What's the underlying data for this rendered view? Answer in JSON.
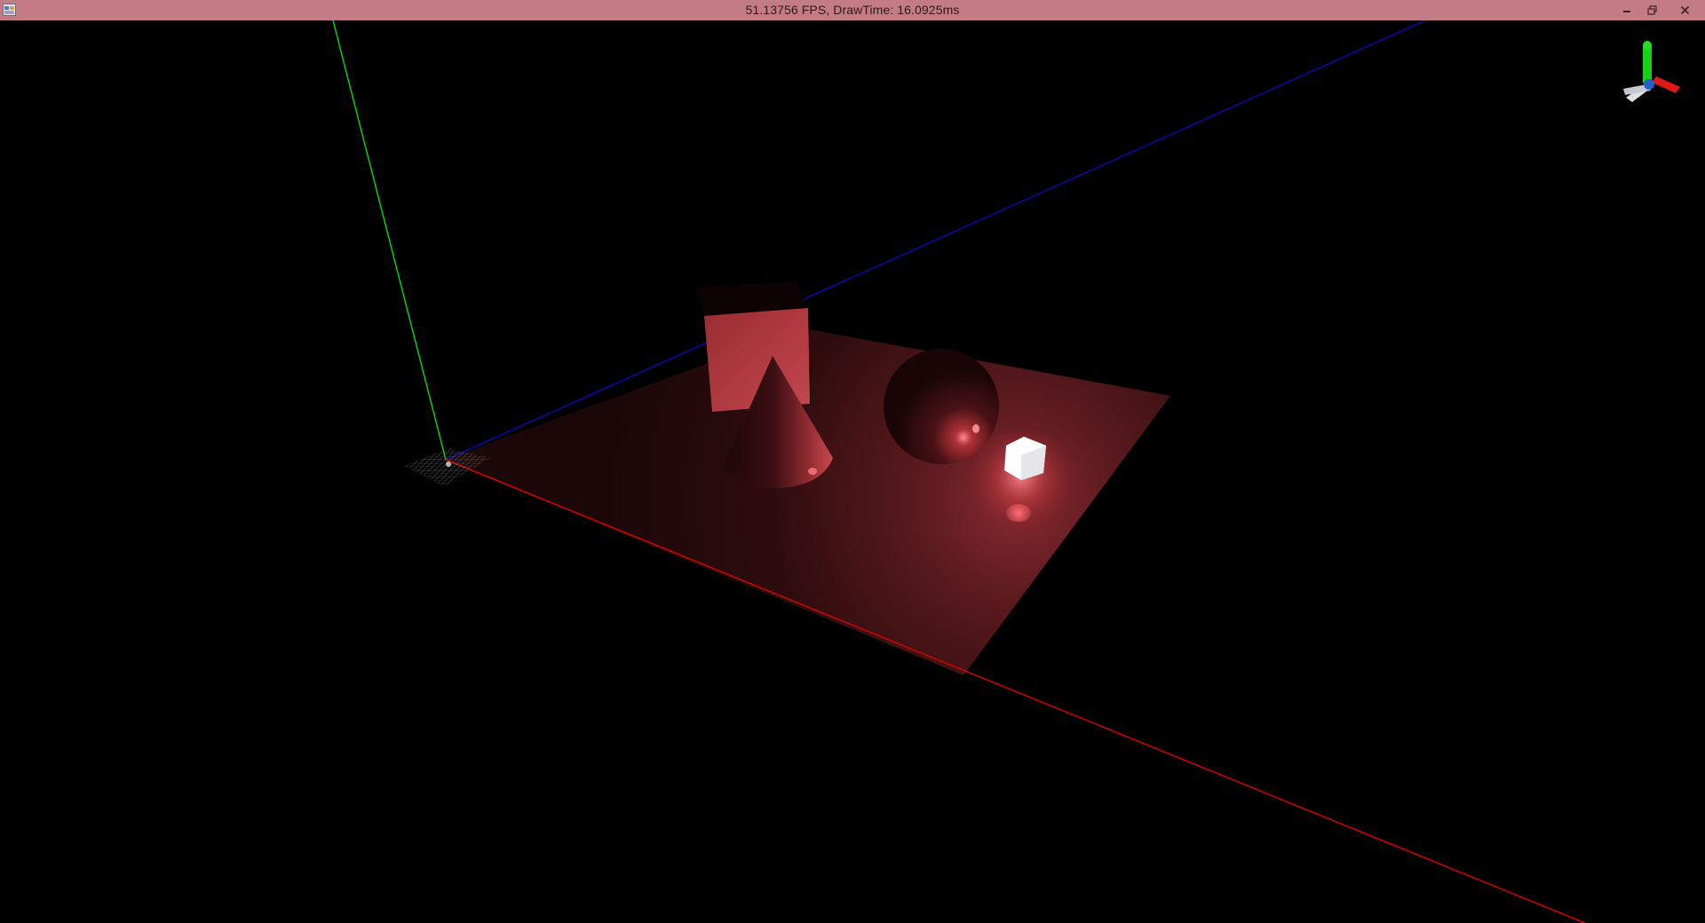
{
  "window": {
    "title": "51.13756 FPS, DrawTime: 16.0925ms",
    "controls": [
      "minimize",
      "restore",
      "close"
    ]
  },
  "scene": {
    "background_color": "#000000",
    "axis_colors": {
      "x": "#ff0000",
      "y": "#00ff00",
      "z": "#0000cc"
    },
    "objects": [
      "ground-plane",
      "box",
      "cone",
      "sphere",
      "light-cube",
      "origin-grid"
    ],
    "object_color": "#b03238",
    "light_color": "#ffffff"
  },
  "orientation_gizmo": {
    "axes": [
      "x",
      "y",
      "z"
    ],
    "colors": {
      "x": "#e01818",
      "y": "#18d018",
      "z": "#1870e0"
    }
  }
}
